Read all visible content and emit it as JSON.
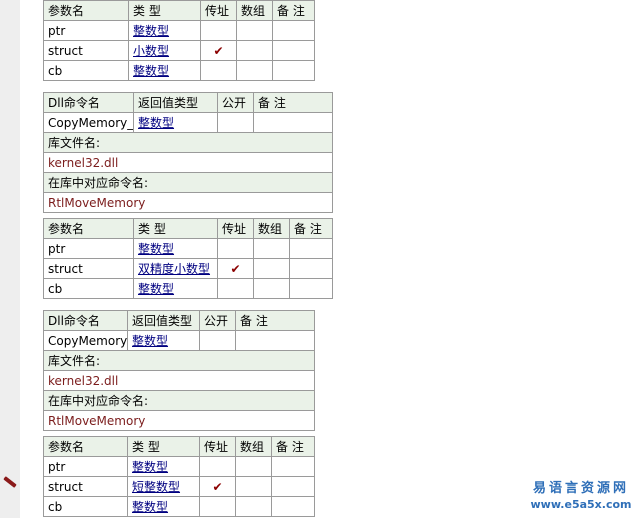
{
  "headers": {
    "param": "参数名",
    "type": "类 型",
    "byref": "传址",
    "array": "数组",
    "note": "备 注",
    "dll_name": "Dll命令名",
    "return_type": "返回值类型",
    "public": "公开",
    "lib_file": "库文件名:",
    "lib_cmd": "在库中对应命令名:"
  },
  "check_mark": "✔",
  "block0": {
    "params": [
      {
        "name": "ptr",
        "type": "整数型"
      },
      {
        "name": "struct",
        "type": "小数型"
      },
      {
        "name": "cb",
        "type": "整数型"
      }
    ]
  },
  "block1": {
    "command": "CopyMemory_sj",
    "return_type": "整数型",
    "lib_file": "kernel32.dll",
    "lib_cmd": "RtlMoveMemory",
    "params": [
      {
        "name": "ptr",
        "type": "整数型"
      },
      {
        "name": "struct",
        "type": "双精度小数型"
      },
      {
        "name": "cb",
        "type": "整数型"
      }
    ]
  },
  "block2": {
    "command": "CopyMemory_d",
    "return_type": "整数型",
    "lib_file": "kernel32.dll",
    "lib_cmd": "RtlMoveMemory",
    "params": [
      {
        "name": "ptr",
        "type": "整数型"
      },
      {
        "name": "struct",
        "type": "短整数型"
      },
      {
        "name": "cb",
        "type": "整数型"
      }
    ]
  },
  "watermark": {
    "line1": "易语言资源网",
    "line2": "www.e5a5x.com"
  },
  "icons": {
    "gutter_marker": "pencil-icon",
    "byref_check": "checkmark-icon"
  },
  "colors": {
    "header_bg": "#eaf2e8",
    "type_link": "#000080",
    "lib_text": "#7b1c1c",
    "check": "#8b0000",
    "watermark": "#2f6fb8"
  }
}
